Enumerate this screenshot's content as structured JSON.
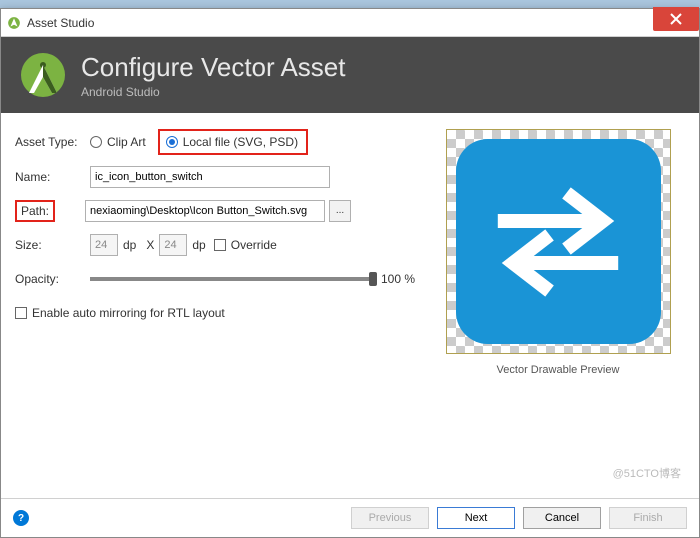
{
  "window": {
    "title": "Asset Studio"
  },
  "header": {
    "title": "Configure Vector Asset",
    "subtitle": "Android Studio"
  },
  "form": {
    "assetTypeLabel": "Asset Type:",
    "clipArt": "Clip Art",
    "localFile": "Local file (SVG, PSD)",
    "nameLabel": "Name:",
    "nameValue": "ic_icon_button_switch",
    "pathLabel": "Path:",
    "pathValue": "nexiaoming\\Desktop\\Icon Button_Switch.svg",
    "browse": "...",
    "sizeLabel": "Size:",
    "sizeW": "24",
    "sizeH": "24",
    "dp": "dp",
    "x": "X",
    "overrideLabel": "Override",
    "opacityLabel": "Opacity:",
    "opacityValue": "100 %",
    "mirrorLabel": "Enable auto mirroring for RTL layout"
  },
  "preview": {
    "label": "Vector Drawable Preview"
  },
  "footer": {
    "previous": "Previous",
    "next": "Next",
    "cancel": "Cancel",
    "finish": "Finish"
  },
  "watermark": "@51CTO博客"
}
